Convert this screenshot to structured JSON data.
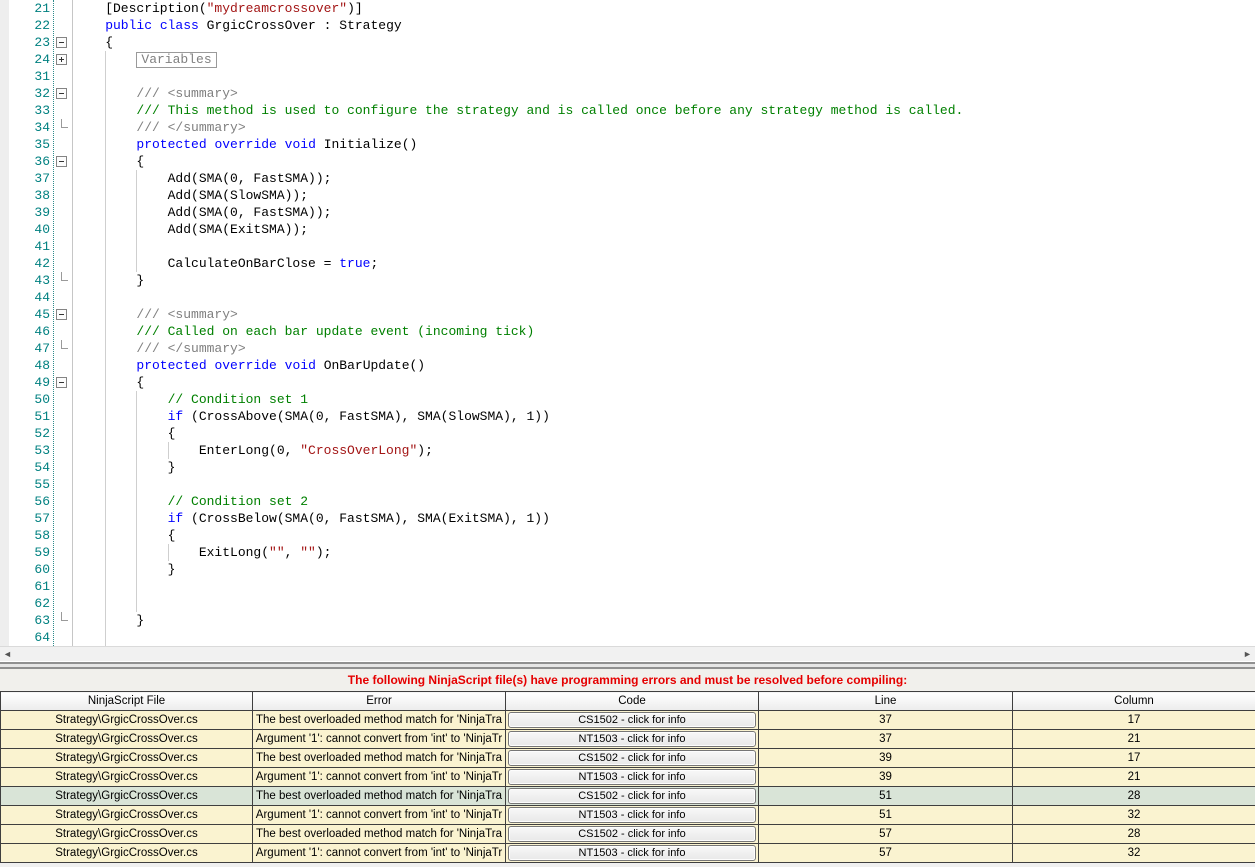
{
  "colors": {
    "keyword": "#0000ff",
    "comment": "#008000",
    "doc": "#808080",
    "string": "#a31515",
    "line_number": "#008080",
    "error_text": "#e50000",
    "row_bg": "#faf3d0",
    "selected_row_bg": "#d9e4d7"
  },
  "icons": {
    "scroll_left": "◄",
    "scroll_right": "►"
  },
  "editor": {
    "collapsed_region_label": "Variables",
    "lines": [
      {
        "n": "21",
        "i": 4,
        "f": "",
        "g": [],
        "t": [
          [
            "n",
            "[Description("
          ],
          [
            "s",
            "\"mydreamcrossover\""
          ],
          [
            "n",
            ")]"
          ]
        ]
      },
      {
        "n": "22",
        "i": 4,
        "f": "",
        "g": [],
        "t": [
          [
            "k",
            "public"
          ],
          [
            "n",
            " "
          ],
          [
            "k",
            "class"
          ],
          [
            "n",
            " GrgicCrossOver : Strategy"
          ]
        ]
      },
      {
        "n": "23",
        "i": 4,
        "f": "minus",
        "g": [],
        "t": [
          [
            "n",
            "{"
          ]
        ]
      },
      {
        "n": "24",
        "i": 8,
        "f": "plus",
        "g": [
          4
        ],
        "box": true,
        "t": []
      },
      {
        "n": "31",
        "i": 0,
        "f": "",
        "g": [
          4
        ],
        "t": []
      },
      {
        "n": "32",
        "i": 8,
        "f": "minus",
        "g": [
          4
        ],
        "t": [
          [
            "d",
            "/// <summary>"
          ]
        ]
      },
      {
        "n": "33",
        "i": 8,
        "f": "",
        "g": [
          4
        ],
        "t": [
          [
            "c",
            "/// This method is used to configure the strategy and is called once before any strategy method is called."
          ]
        ]
      },
      {
        "n": "34",
        "i": 8,
        "f": "tick",
        "g": [
          4
        ],
        "t": [
          [
            "d",
            "/// </summary>"
          ]
        ]
      },
      {
        "n": "35",
        "i": 8,
        "f": "",
        "g": [
          4
        ],
        "t": [
          [
            "k",
            "protected"
          ],
          [
            "n",
            " "
          ],
          [
            "k",
            "override"
          ],
          [
            "n",
            " "
          ],
          [
            "k",
            "void"
          ],
          [
            "n",
            " Initialize()"
          ]
        ]
      },
      {
        "n": "36",
        "i": 8,
        "f": "minus",
        "g": [
          4
        ],
        "t": [
          [
            "n",
            "{"
          ]
        ]
      },
      {
        "n": "37",
        "i": 12,
        "f": "",
        "g": [
          4,
          8
        ],
        "t": [
          [
            "n",
            "Add(SMA(0, FastSMA));"
          ]
        ]
      },
      {
        "n": "38",
        "i": 12,
        "f": "",
        "g": [
          4,
          8
        ],
        "t": [
          [
            "n",
            "Add(SMA(SlowSMA));"
          ]
        ]
      },
      {
        "n": "39",
        "i": 12,
        "f": "",
        "g": [
          4,
          8
        ],
        "t": [
          [
            "n",
            "Add(SMA(0, FastSMA));"
          ]
        ]
      },
      {
        "n": "40",
        "i": 12,
        "f": "",
        "g": [
          4,
          8
        ],
        "t": [
          [
            "n",
            "Add(SMA(ExitSMA));"
          ]
        ]
      },
      {
        "n": "41",
        "i": 0,
        "f": "",
        "g": [
          4,
          8
        ],
        "t": []
      },
      {
        "n": "42",
        "i": 12,
        "f": "",
        "g": [
          4,
          8
        ],
        "t": [
          [
            "n",
            "CalculateOnBarClose = "
          ],
          [
            "k",
            "true"
          ],
          [
            "n",
            ";"
          ]
        ]
      },
      {
        "n": "43",
        "i": 8,
        "f": "tick",
        "g": [
          4
        ],
        "t": [
          [
            "n",
            "}"
          ]
        ]
      },
      {
        "n": "44",
        "i": 0,
        "f": "",
        "g": [
          4
        ],
        "t": []
      },
      {
        "n": "45",
        "i": 8,
        "f": "minus",
        "g": [
          4
        ],
        "t": [
          [
            "d",
            "/// <summary>"
          ]
        ]
      },
      {
        "n": "46",
        "i": 8,
        "f": "",
        "g": [
          4
        ],
        "t": [
          [
            "c",
            "/// Called on each bar update event (incoming tick)"
          ]
        ]
      },
      {
        "n": "47",
        "i": 8,
        "f": "tick",
        "g": [
          4
        ],
        "t": [
          [
            "d",
            "/// </summary>"
          ]
        ]
      },
      {
        "n": "48",
        "i": 8,
        "f": "",
        "g": [
          4
        ],
        "t": [
          [
            "k",
            "protected"
          ],
          [
            "n",
            " "
          ],
          [
            "k",
            "override"
          ],
          [
            "n",
            " "
          ],
          [
            "k",
            "void"
          ],
          [
            "n",
            " OnBarUpdate()"
          ]
        ]
      },
      {
        "n": "49",
        "i": 8,
        "f": "minus",
        "g": [
          4
        ],
        "t": [
          [
            "n",
            "{"
          ]
        ]
      },
      {
        "n": "50",
        "i": 12,
        "f": "",
        "g": [
          4,
          8
        ],
        "t": [
          [
            "c",
            "// Condition set 1"
          ]
        ]
      },
      {
        "n": "51",
        "i": 12,
        "f": "",
        "g": [
          4,
          8
        ],
        "t": [
          [
            "k",
            "if"
          ],
          [
            "n",
            " (CrossAbove(SMA(0, FastSMA), SMA(SlowSMA), 1))"
          ]
        ]
      },
      {
        "n": "52",
        "i": 12,
        "f": "",
        "g": [
          4,
          8
        ],
        "t": [
          [
            "n",
            "{"
          ]
        ]
      },
      {
        "n": "53",
        "i": 16,
        "f": "",
        "g": [
          4,
          8,
          12
        ],
        "t": [
          [
            "n",
            "EnterLong(0, "
          ],
          [
            "s",
            "\"CrossOverLong\""
          ],
          [
            "n",
            ");"
          ]
        ]
      },
      {
        "n": "54",
        "i": 12,
        "f": "",
        "g": [
          4,
          8
        ],
        "t": [
          [
            "n",
            "}"
          ]
        ]
      },
      {
        "n": "55",
        "i": 0,
        "f": "",
        "g": [
          4,
          8
        ],
        "t": []
      },
      {
        "n": "56",
        "i": 12,
        "f": "",
        "g": [
          4,
          8
        ],
        "t": [
          [
            "c",
            "// Condition set 2"
          ]
        ]
      },
      {
        "n": "57",
        "i": 12,
        "f": "",
        "g": [
          4,
          8
        ],
        "t": [
          [
            "k",
            "if"
          ],
          [
            "n",
            " (CrossBelow(SMA(0, FastSMA), SMA(ExitSMA), 1))"
          ]
        ]
      },
      {
        "n": "58",
        "i": 12,
        "f": "",
        "g": [
          4,
          8
        ],
        "t": [
          [
            "n",
            "{"
          ]
        ]
      },
      {
        "n": "59",
        "i": 16,
        "f": "",
        "g": [
          4,
          8,
          12
        ],
        "t": [
          [
            "n",
            "ExitLong("
          ],
          [
            "s",
            "\"\""
          ],
          [
            "n",
            ", "
          ],
          [
            "s",
            "\"\""
          ],
          [
            "n",
            ");"
          ]
        ]
      },
      {
        "n": "60",
        "i": 12,
        "f": "",
        "g": [
          4,
          8
        ],
        "t": [
          [
            "n",
            "}"
          ]
        ]
      },
      {
        "n": "61",
        "i": 0,
        "f": "",
        "g": [
          4,
          8
        ],
        "t": []
      },
      {
        "n": "62",
        "i": 0,
        "f": "",
        "g": [
          4,
          8
        ],
        "t": []
      },
      {
        "n": "63",
        "i": 8,
        "f": "tick",
        "g": [
          4
        ],
        "t": [
          [
            "n",
            "}"
          ]
        ]
      },
      {
        "n": "64",
        "i": 0,
        "f": "",
        "g": [
          4
        ],
        "t": []
      }
    ]
  },
  "error_panel": {
    "message": "The following NinjaScript file(s) have programming errors and must be resolved before compiling:",
    "table": {
      "columns": [
        "NinjaScript File",
        "Error",
        "Code",
        "Line",
        "Column"
      ],
      "rows": [
        {
          "file": "Strategy\\GrgicCrossOver.cs",
          "error": "The best overloaded method match for 'NinjaTra",
          "code": "CS1502 - click for info",
          "line": "37",
          "column": "17",
          "selected": false
        },
        {
          "file": "Strategy\\GrgicCrossOver.cs",
          "error": "Argument '1': cannot convert from 'int' to 'NinjaTr",
          "code": "NT1503 - click for info",
          "line": "37",
          "column": "21",
          "selected": false
        },
        {
          "file": "Strategy\\GrgicCrossOver.cs",
          "error": "The best overloaded method match for 'NinjaTra",
          "code": "CS1502 - click for info",
          "line": "39",
          "column": "17",
          "selected": false
        },
        {
          "file": "Strategy\\GrgicCrossOver.cs",
          "error": "Argument '1': cannot convert from 'int' to 'NinjaTr",
          "code": "NT1503 - click for info",
          "line": "39",
          "column": "21",
          "selected": false
        },
        {
          "file": "Strategy\\GrgicCrossOver.cs",
          "error": "The best overloaded method match for 'NinjaTra",
          "code": "CS1502 - click for info",
          "line": "51",
          "column": "28",
          "selected": true
        },
        {
          "file": "Strategy\\GrgicCrossOver.cs",
          "error": "Argument '1': cannot convert from 'int' to 'NinjaTr",
          "code": "NT1503 - click for info",
          "line": "51",
          "column": "32",
          "selected": false
        },
        {
          "file": "Strategy\\GrgicCrossOver.cs",
          "error": "The best overloaded method match for 'NinjaTra",
          "code": "CS1502 - click for info",
          "line": "57",
          "column": "28",
          "selected": false
        },
        {
          "file": "Strategy\\GrgicCrossOver.cs",
          "error": "Argument '1': cannot convert from 'int' to 'NinjaTr",
          "code": "NT1503 - click for info",
          "line": "57",
          "column": "32",
          "selected": false
        }
      ]
    }
  }
}
